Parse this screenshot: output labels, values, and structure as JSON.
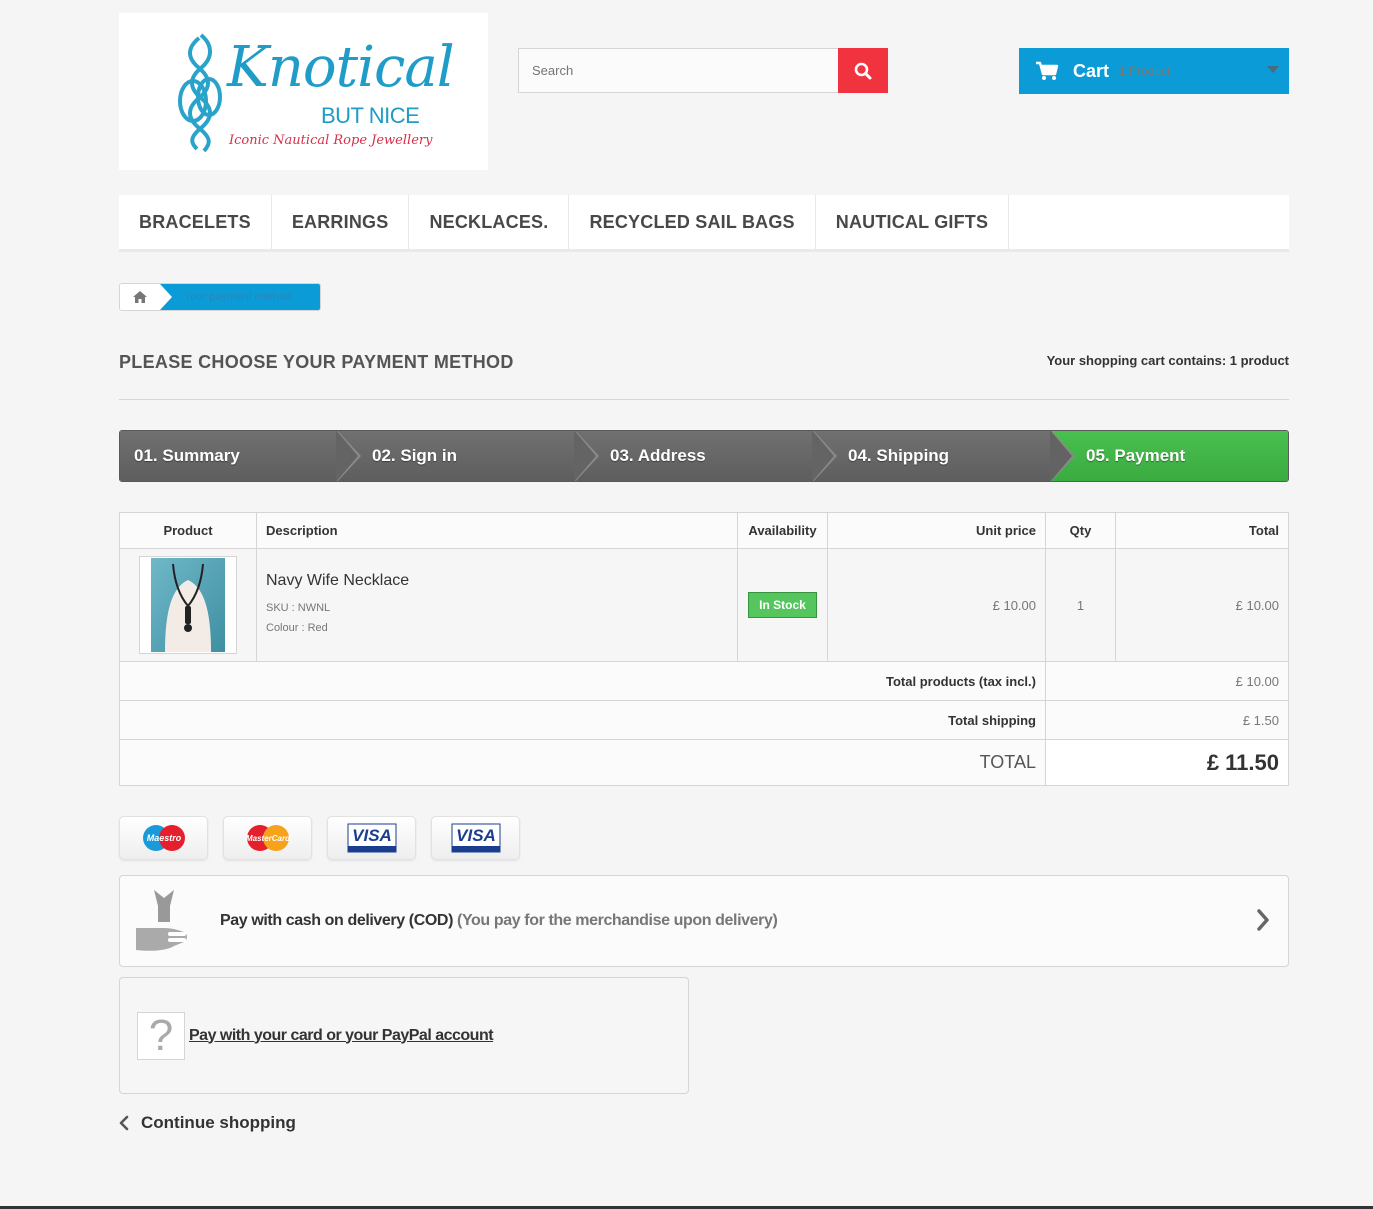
{
  "header": {
    "logo": {
      "title": "Knotical",
      "subtitle": "BUT NICE",
      "tagline": "Iconic Nautical Rope Jewellery"
    },
    "search": {
      "placeholder": "Search",
      "value": ""
    },
    "cart": {
      "label": "Cart",
      "count": "1 Product"
    }
  },
  "menu": {
    "items": [
      "BRACELETS",
      "EARRINGS",
      "NECKLACES.",
      "RECYCLED SAIL BAGS",
      "NAUTICAL GIFTS"
    ]
  },
  "breadcrumb": {
    "current": "Your payment method"
  },
  "page": {
    "heading": "PLEASE CHOOSE YOUR PAYMENT METHOD",
    "cart_summary": "Your shopping cart contains: 1 product"
  },
  "steps": [
    "01. Summary",
    "02. Sign in",
    "03. Address",
    "04. Shipping",
    "05. Payment"
  ],
  "table": {
    "headers": {
      "product": "Product",
      "description": "Description",
      "availability": "Availability",
      "unit_price": "Unit price",
      "qty": "Qty",
      "total": "Total"
    },
    "rows": [
      {
        "name": "Navy Wife Necklace",
        "sku": "SKU : NWNL",
        "colour": "Colour : Red",
        "availability": "In Stock",
        "unit_price": "£ 10.00",
        "qty": "1",
        "total": "£ 10.00"
      }
    ],
    "totals": {
      "products_label": "Total products (tax incl.)",
      "products_value": "£ 10.00",
      "shipping_label": "Total shipping",
      "shipping_value": "£ 1.50",
      "total_label": "TOTAL",
      "total_value": "£ 11.50"
    }
  },
  "card_logos": [
    "Maestro",
    "MasterCard",
    "VISA",
    "VISA"
  ],
  "payment": {
    "cod_text": "Pay with cash on delivery (COD)",
    "cod_subtext": "(You pay for the merchandise upon delivery)",
    "card_text": "Pay with your card or your PayPal account"
  },
  "footer": {
    "continue": "Continue shopping"
  },
  "colors": {
    "brand_blue": "#0b9bd6",
    "search_red": "#f13340",
    "step_active": "#46bd4c",
    "step_inactive": "#666666",
    "in_stock": "#55c65e"
  },
  "icons": {
    "search": "search-icon",
    "cart": "cart-icon",
    "home": "home-icon",
    "cod": "cash-hand-icon",
    "card": "question-icon",
    "chevron": "chevron-right-icon",
    "continue": "chevron-left-icon"
  }
}
